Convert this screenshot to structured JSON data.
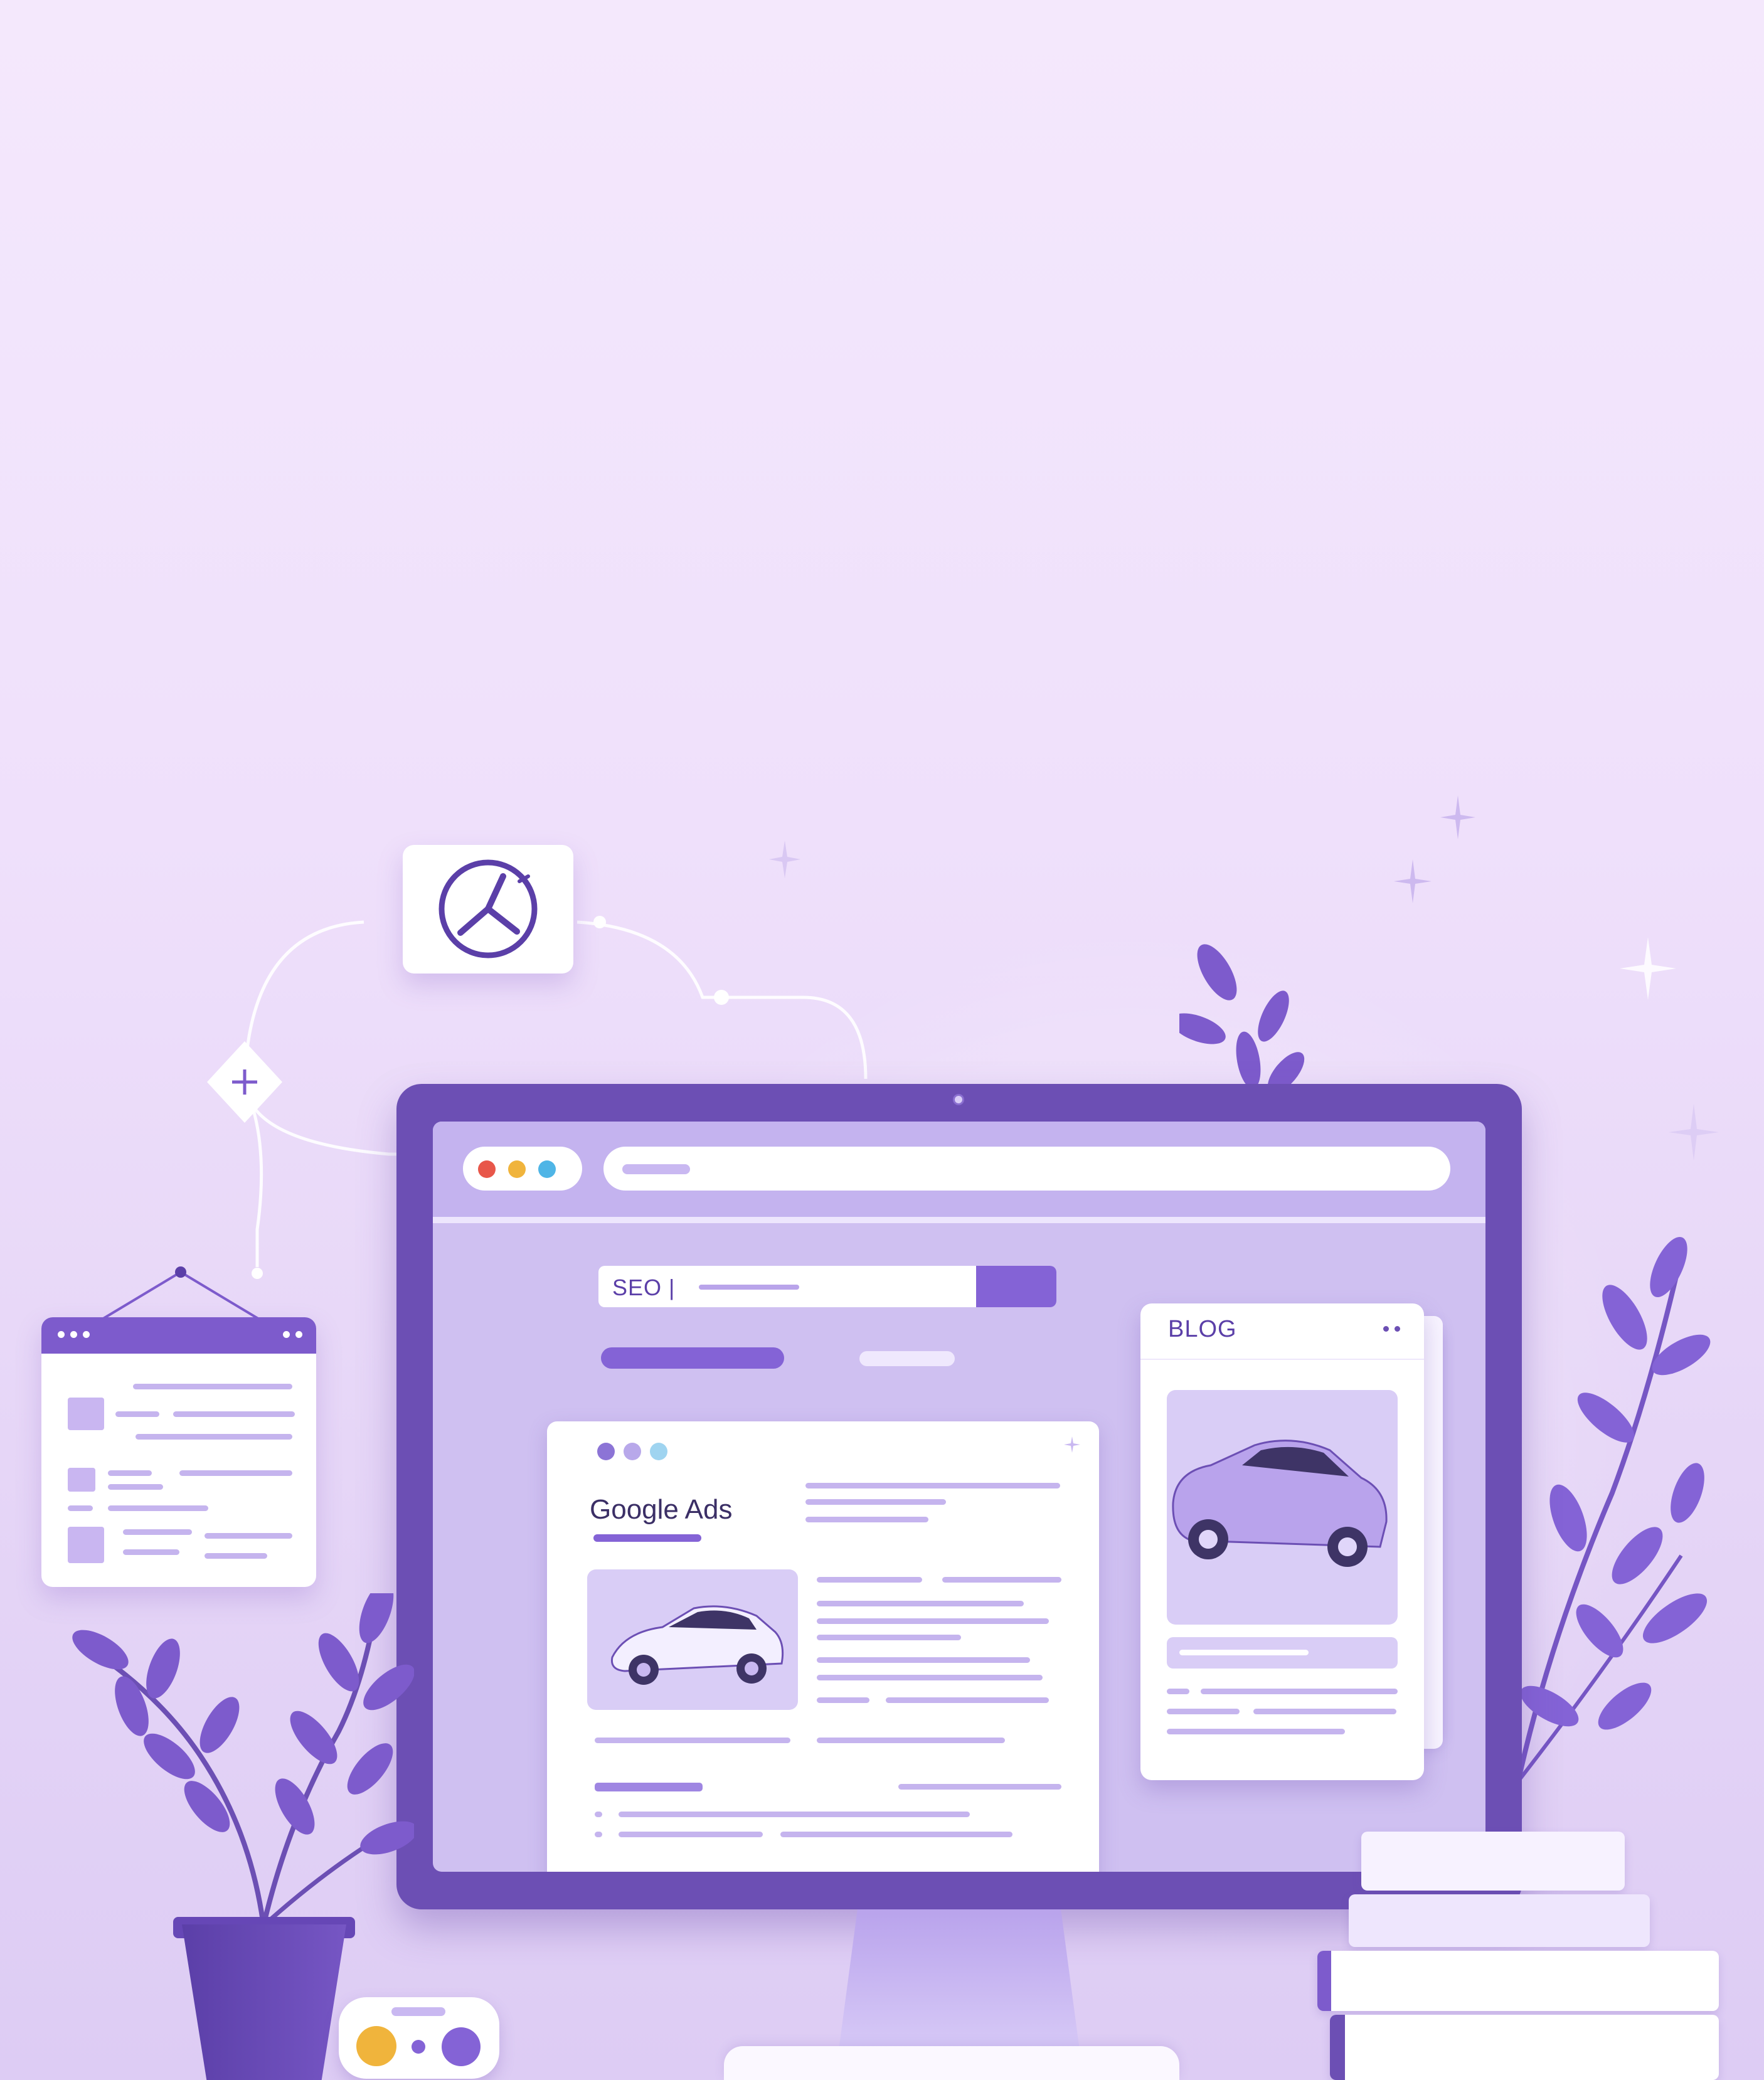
{
  "monitor": {
    "search_text": "SEO |",
    "ads_card": {
      "title": "Google Ads"
    },
    "blog_card": {
      "title": "BLOG"
    },
    "traffic_light_colors": [
      "#e8574a",
      "#f0b43c",
      "#4fb5e6"
    ],
    "ads_dot_colors": [
      "#8c74d6",
      "#b8a8ea",
      "#9fd4f0"
    ]
  },
  "palette": {
    "primary": "#6c4fb4",
    "accent": "#8463d6",
    "background": "#f1e5fb"
  },
  "icons": {
    "logo_card": "tri-blade-logo-icon",
    "sparkles": "sparkle-icon",
    "plants": "leaf-branch-icon"
  }
}
